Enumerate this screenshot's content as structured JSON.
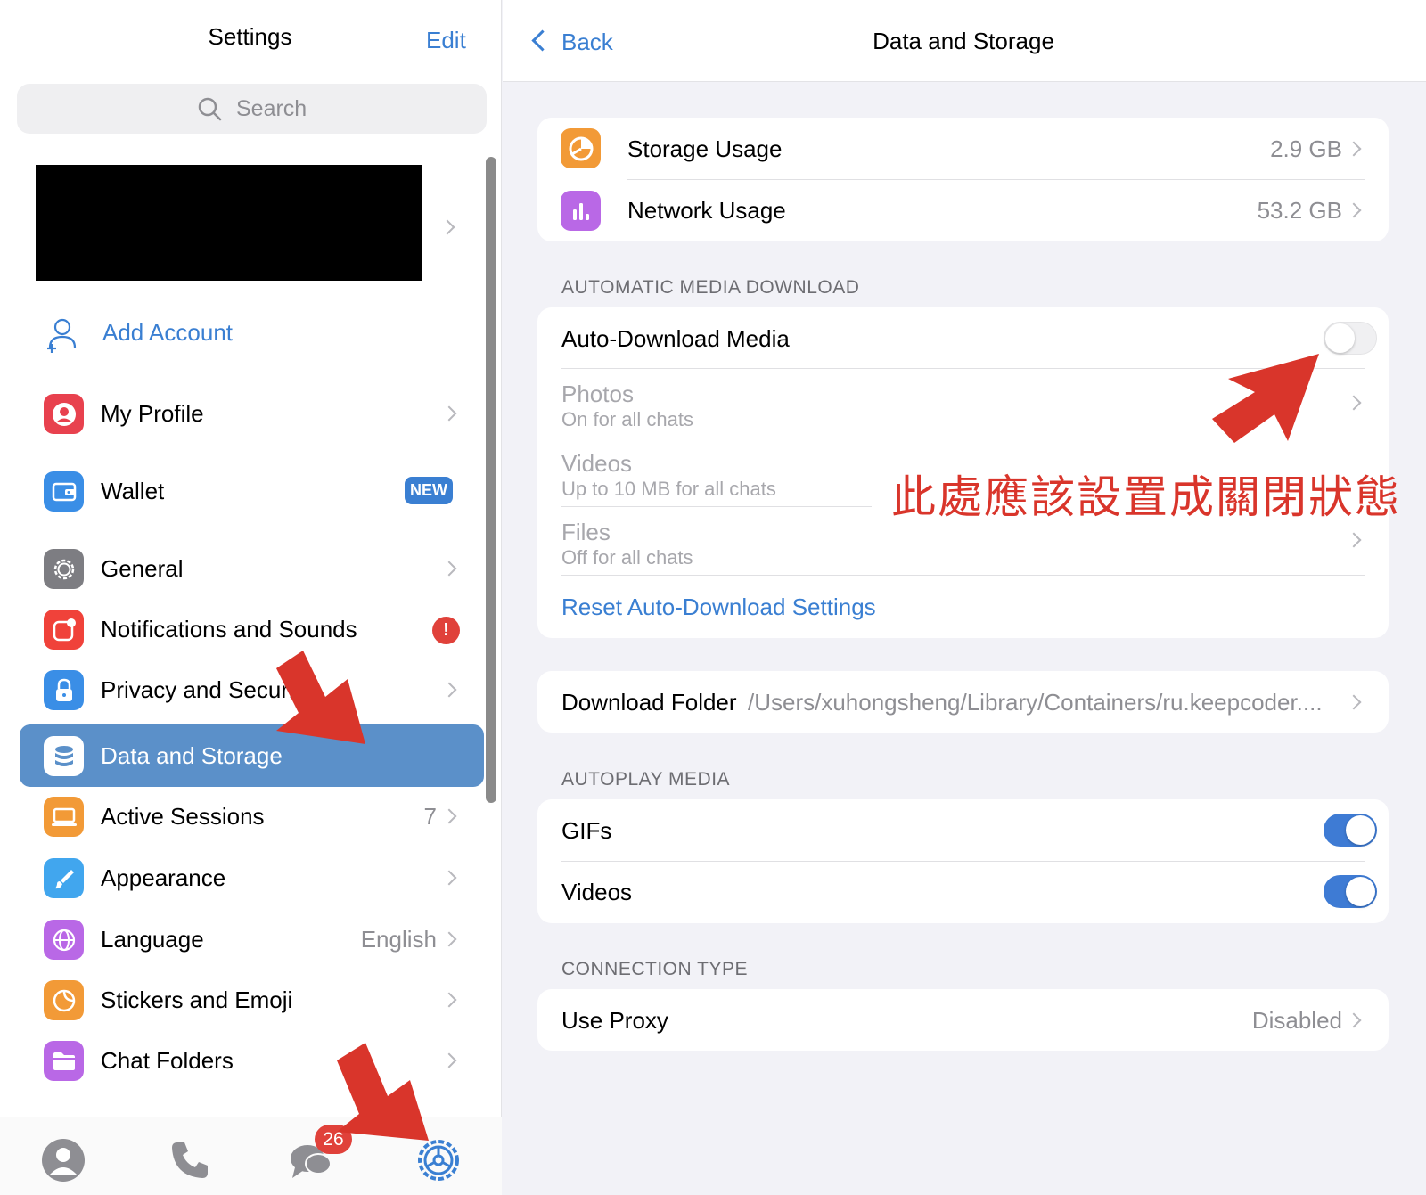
{
  "left": {
    "title": "Settings",
    "edit_label": "Edit",
    "search_placeholder": "Search",
    "add_account_label": "Add Account",
    "items": [
      {
        "label": "My Profile",
        "icon": "person-icon",
        "color": "#e8414e"
      },
      {
        "label": "Wallet",
        "icon": "wallet-icon",
        "color": "#3a8ee6",
        "badge": "NEW"
      },
      {
        "label": "General",
        "icon": "gear-icon",
        "color": "#7d7d82"
      },
      {
        "label": "Notifications and Sounds",
        "icon": "notification-icon",
        "color": "#f0423a",
        "badge": "!"
      },
      {
        "label": "Privacy and Securi",
        "icon": "lock-icon",
        "color": "#3a8ee6"
      },
      {
        "label": "Data and Storage",
        "icon": "database-icon",
        "color": "#4cb3f5",
        "selected": true
      },
      {
        "label": "Active Sessions",
        "icon": "laptop-icon",
        "color": "#f29a37",
        "value": "7"
      },
      {
        "label": "Appearance",
        "icon": "brush-icon",
        "color": "#41a6ee"
      },
      {
        "label": "Language",
        "icon": "globe-icon",
        "color": "#b968e6",
        "value": "English"
      },
      {
        "label": "Stickers and Emoji",
        "icon": "sticker-icon",
        "color": "#f29a37"
      },
      {
        "label": "Chat Folders",
        "icon": "folder-icon",
        "color": "#b968e6"
      }
    ],
    "tabbar": {
      "tabs": [
        "contacts-tab",
        "calls-tab",
        "chats-tab",
        "settings-tab"
      ],
      "chat_badge": "26"
    }
  },
  "right": {
    "back_label": "Back",
    "title": "Data and Storage",
    "usage": {
      "storage_label": "Storage Usage",
      "storage_value": "2.9 GB",
      "network_label": "Network Usage",
      "network_value": "53.2 GB"
    },
    "auto_download": {
      "header": "AUTOMATIC MEDIA DOWNLOAD",
      "toggle_label": "Auto-Download Media",
      "toggle_on": false,
      "photos_label": "Photos",
      "photos_sub": "On for all chats",
      "videos_label": "Videos",
      "videos_sub": "Up to 10 MB for all chats",
      "files_label": "Files",
      "files_sub": "Off for all chats",
      "reset_label": "Reset Auto-Download Settings"
    },
    "download_folder": {
      "label": "Download Folder",
      "path": "/Users/xuhongsheng/Library/Containers/ru.keepcoder...."
    },
    "autoplay": {
      "header": "AUTOPLAY MEDIA",
      "gifs_label": "GIFs",
      "gifs_on": true,
      "videos_label": "Videos",
      "videos_on": true
    },
    "connection": {
      "header": "CONNECTION TYPE",
      "proxy_label": "Use Proxy",
      "proxy_value": "Disabled"
    }
  },
  "annotation": {
    "text": "此處應該設置成關閉狀態",
    "color": "#d9352b"
  },
  "colors": {
    "accent": "#3a7fd2",
    "selected_row": "#5b90c9",
    "toggle_on": "#3e7bd4",
    "badge_red": "#e0413a"
  }
}
